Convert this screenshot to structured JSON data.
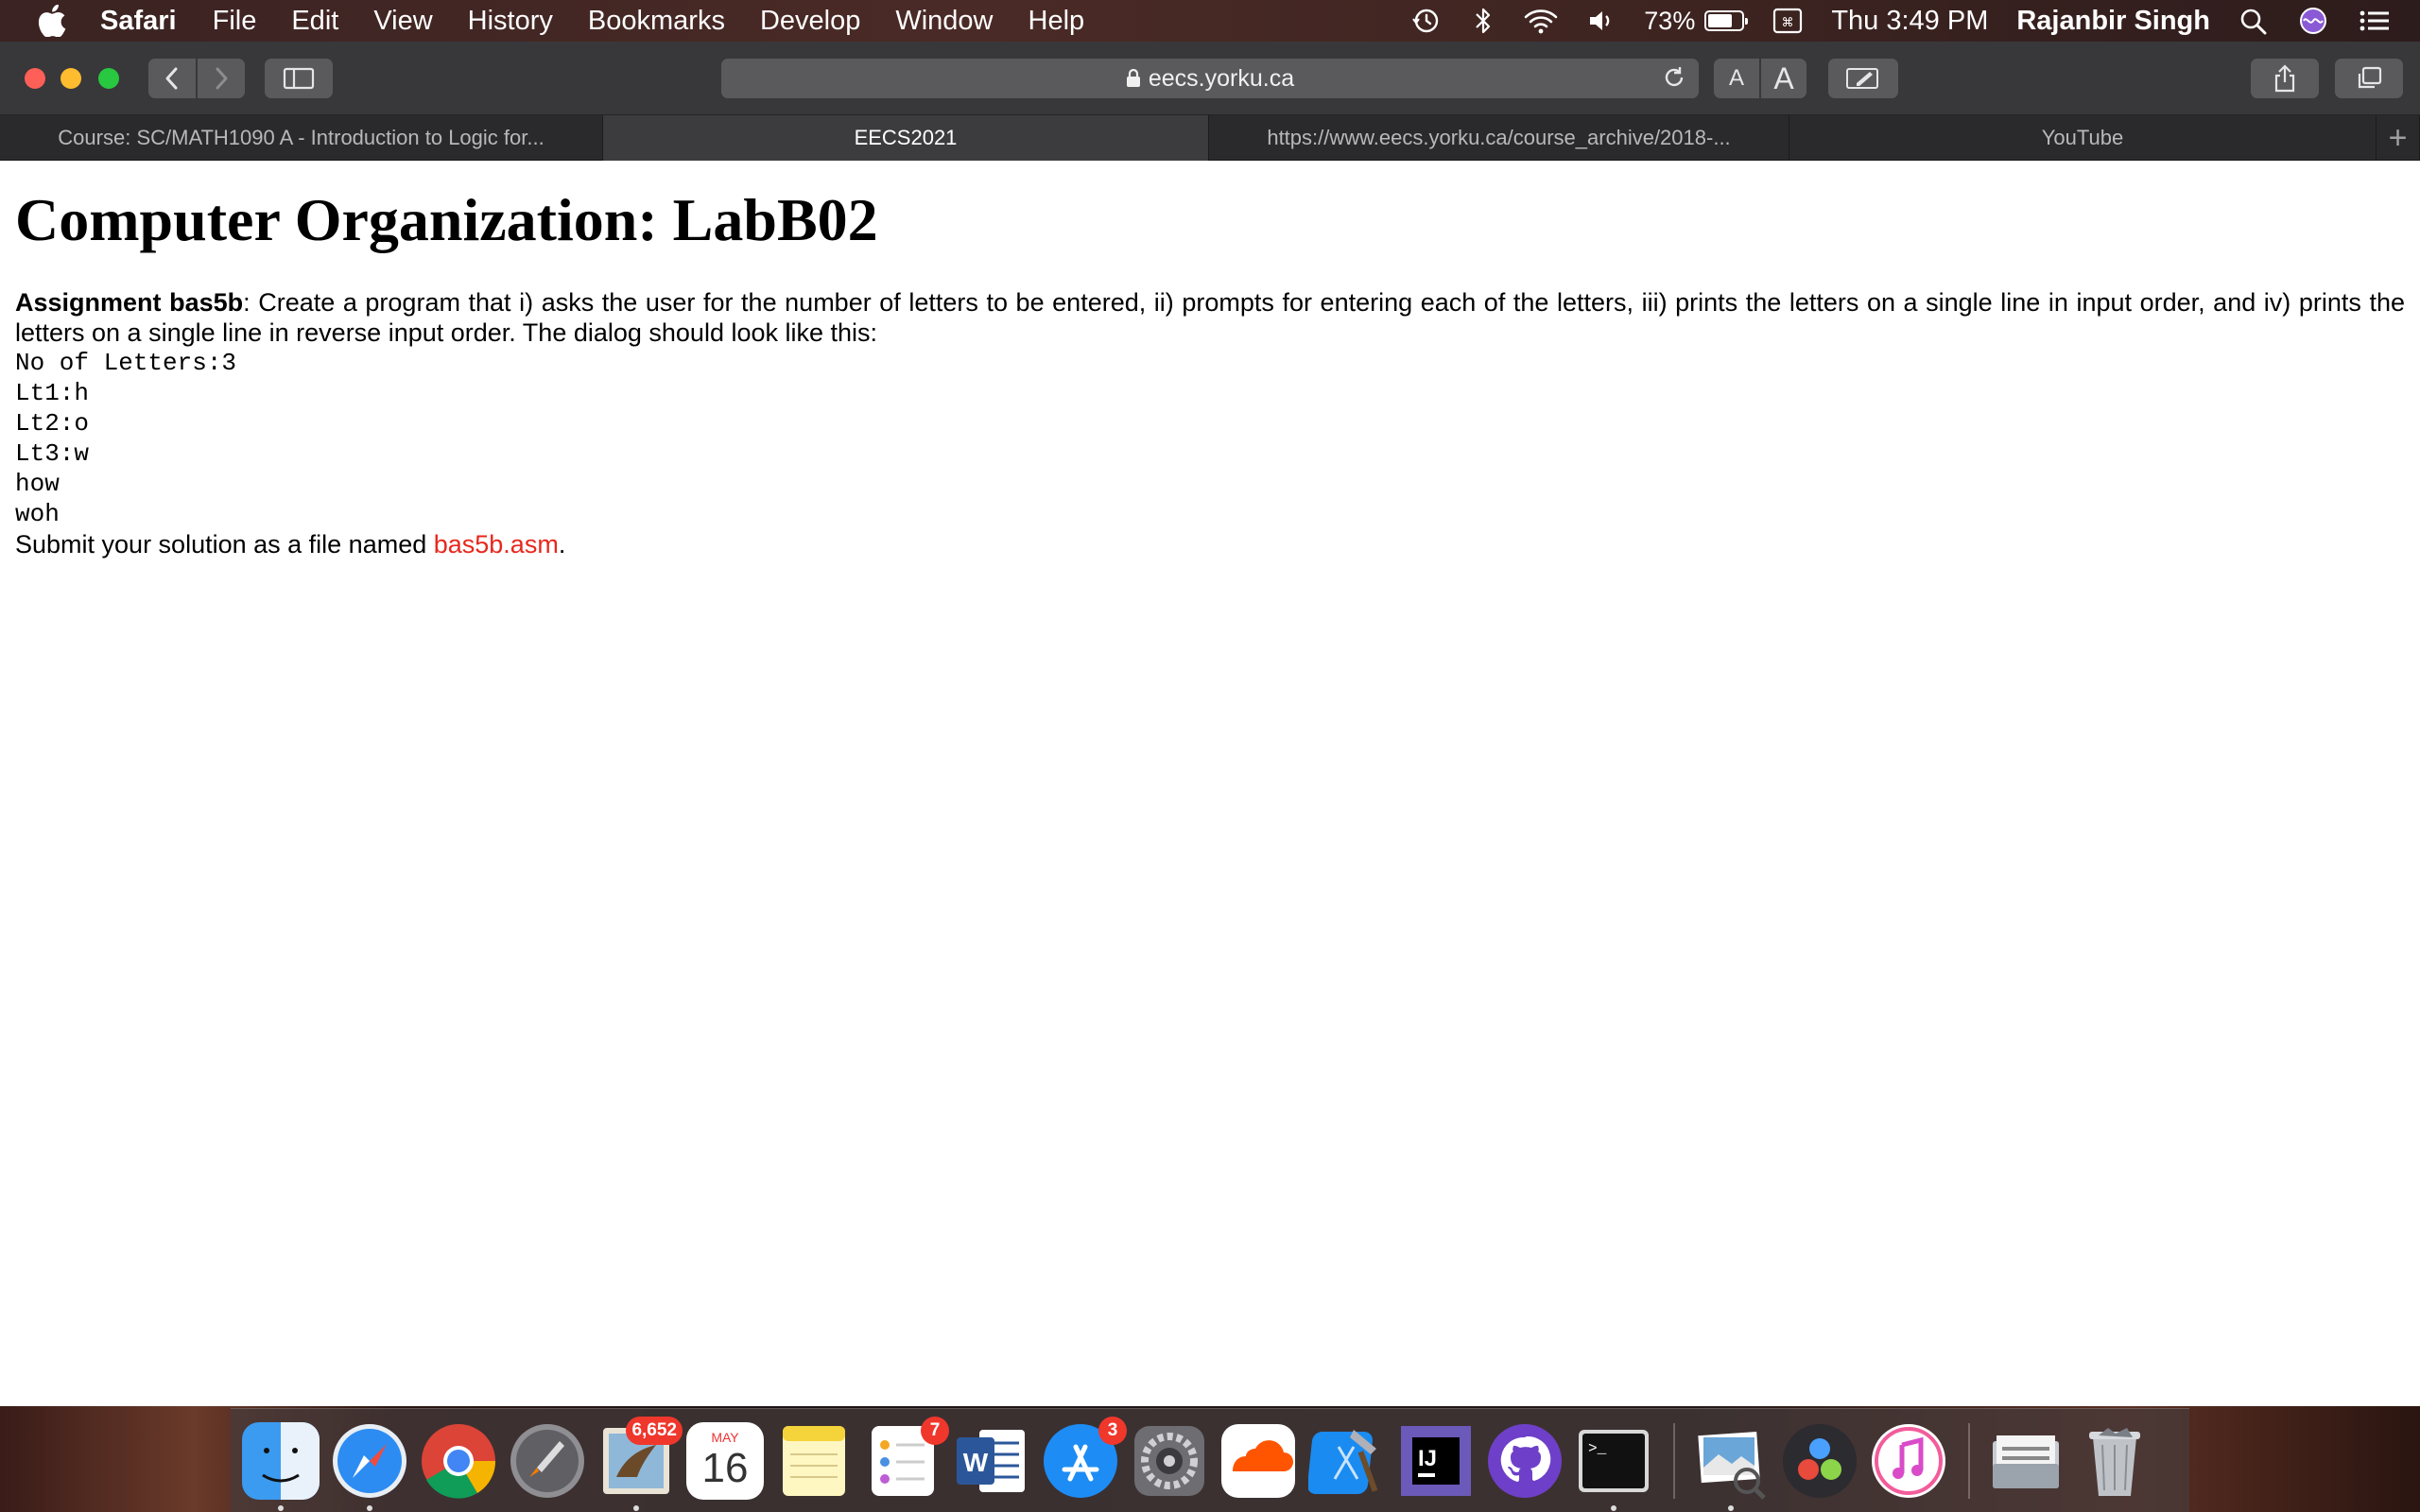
{
  "menubar": {
    "app_name": "Safari",
    "menus": [
      "File",
      "Edit",
      "View",
      "History",
      "Bookmarks",
      "Develop",
      "Window",
      "Help"
    ],
    "battery_percent": "73%",
    "battery_level": 0.73,
    "clock": "Thu 3:49 PM",
    "user": "Rajanbir Singh"
  },
  "toolbar": {
    "address": "eecs.yorku.ca",
    "text_smaller_label": "A",
    "text_larger_label": "A"
  },
  "tabs": [
    {
      "label": "Course: SC/MATH1090 A - Introduction to Logic for...",
      "active": false
    },
    {
      "label": "EECS2021",
      "active": true
    },
    {
      "label": "https://www.eecs.yorku.ca/course_archive/2018-...",
      "active": false
    },
    {
      "label": "YouTube",
      "active": false
    }
  ],
  "tab_add_label": "+",
  "page": {
    "title": "Computer Organization: LabB02",
    "assignment_name": "Assignment bas5b",
    "assignment_text": ": Create a program that i) asks the user for the number of letters to be entered, ii) prompts for entering each of the letters, iii) prints the letters on a single line in input order, and iv) prints the letters on a single line in reverse input order. The dialog should look like this:",
    "dialog_lines": [
      "No of Letters:3",
      "Lt1:h",
      "Lt2:o",
      "Lt3:w",
      "how",
      "woh"
    ],
    "submit_prefix": "Submit your solution as a file named ",
    "submit_file": "bas5b.asm",
    "submit_suffix": "."
  },
  "dock": {
    "apps": [
      {
        "name": "finder",
        "running": true
      },
      {
        "name": "safari",
        "running": true
      },
      {
        "name": "chrome",
        "running": false
      },
      {
        "name": "launchpad",
        "running": false
      },
      {
        "name": "mail",
        "running": true,
        "badge": "6,652"
      },
      {
        "name": "calendar",
        "running": false,
        "month": "MAY",
        "day": "16"
      },
      {
        "name": "notes",
        "running": false
      },
      {
        "name": "reminders",
        "running": false,
        "badge": "7"
      },
      {
        "name": "word",
        "running": false
      },
      {
        "name": "app-store",
        "running": false,
        "badge": "3"
      },
      {
        "name": "system-preferences",
        "running": false
      },
      {
        "name": "soundcloud",
        "running": false
      },
      {
        "name": "xcode",
        "running": false
      },
      {
        "name": "intellij",
        "running": false
      },
      {
        "name": "github-desktop",
        "running": false
      },
      {
        "name": "terminal",
        "running": true
      },
      {
        "name": "preview",
        "running": true
      },
      {
        "name": "davinci-resolve",
        "running": false
      },
      {
        "name": "itunes",
        "running": false
      },
      {
        "name": "documents-stack",
        "running": false
      },
      {
        "name": "trash",
        "running": false
      }
    ]
  },
  "colors": {
    "link_red": "#e8271d",
    "badge_red": "#f0372c"
  }
}
